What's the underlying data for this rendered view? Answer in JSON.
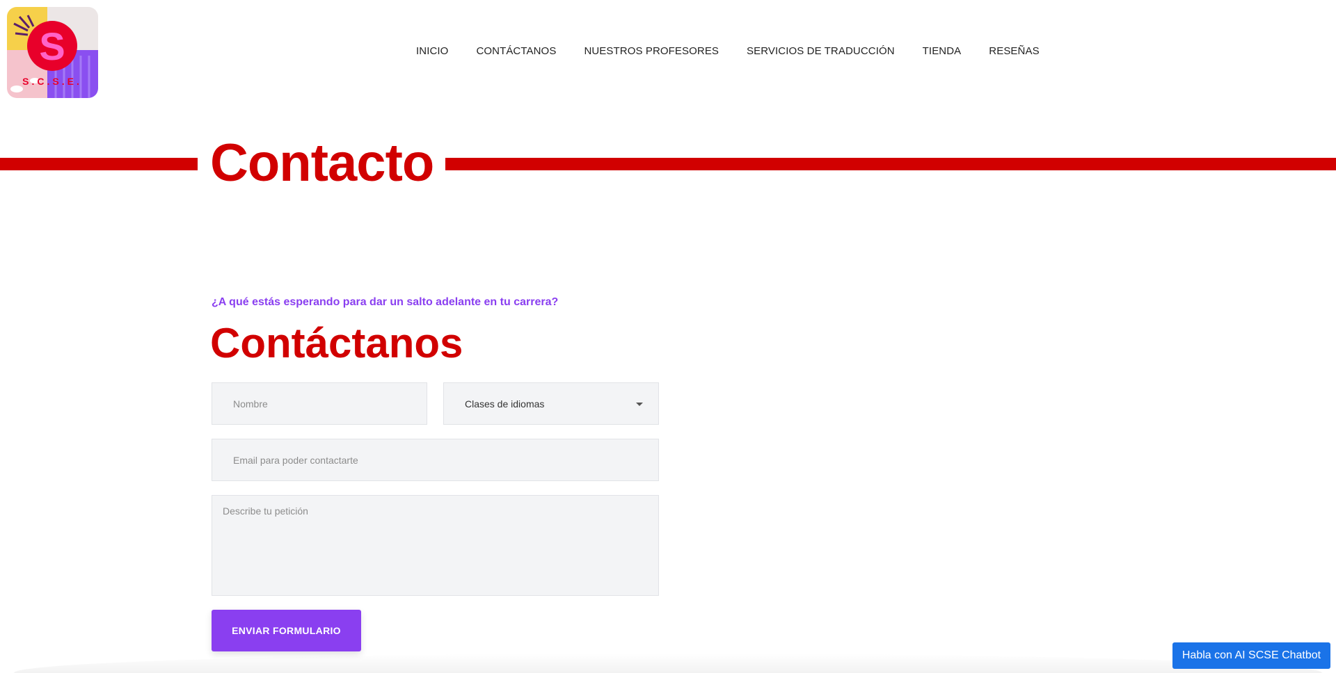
{
  "logo": {
    "initial": "S",
    "letters": "S.C.S.E."
  },
  "nav": {
    "items": [
      {
        "label": "INICIO"
      },
      {
        "label": "CONTÁCTANOS"
      },
      {
        "label": "NUESTROS PROFESORES"
      },
      {
        "label": "SERVICIOS DE TRADUCCIÓN"
      },
      {
        "label": "TIENDA"
      },
      {
        "label": "RESEÑAS"
      }
    ]
  },
  "hero": {
    "title": "Contacto"
  },
  "contact": {
    "kicker": "¿A qué estás esperando para dar un salto adelante en tu carrera?",
    "title": "Contáctanos",
    "form": {
      "name_placeholder": "Nombre",
      "service_selected": "Clases de idiomas",
      "email_placeholder": "Email para poder contactarte",
      "request_placeholder": "Describe tu petición",
      "submit_label": "ENVIAR FORMULARIO"
    }
  },
  "chatbot": {
    "label": "Habla con AI SCSE Chatbot"
  },
  "colors": {
    "brand_red": "#d10000",
    "brand_purple": "#8a3ff0",
    "chatbot_blue": "#1a73e8"
  }
}
